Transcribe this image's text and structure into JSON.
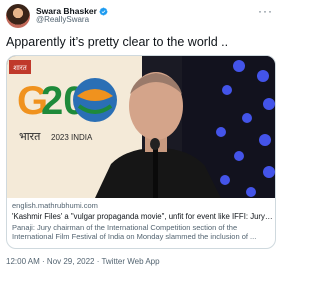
{
  "user": {
    "display_name": "Swara Bhasker",
    "handle": "@ReallySwara",
    "verified": true,
    "avatar_icon": "profile-photo"
  },
  "tweet": {
    "text": "Apparently it’s pretty clear to the world .."
  },
  "card": {
    "image_text": {
      "badge": "शारत",
      "g20_left": "G",
      "g20_right": "20",
      "subline_hindi": "भारत",
      "subline_year": "2023 INDIA"
    },
    "domain": "english.mathrubhumi.com",
    "title": "'Kashmir Files' a \"vulgar propaganda movie\", unfit for event like IFFI: Jury chair...",
    "description_lines": [
      "Panaji: Jury chairman of the International Competition section of the",
      "International Film Festival of India on Monday slammed the inclusion of ..."
    ]
  },
  "meta": {
    "timestamp": "12:00 AM · Nov 29, 2022 · Twitter Web App"
  },
  "colors": {
    "text_primary": "#0f1419",
    "text_secondary": "#536471",
    "verified_blue": "#1d9bf0",
    "card_border": "#cfd9de",
    "g20_orange": "#f0921e",
    "g20_green": "#1e8a3a",
    "stage_dark": "#1a1a24"
  }
}
